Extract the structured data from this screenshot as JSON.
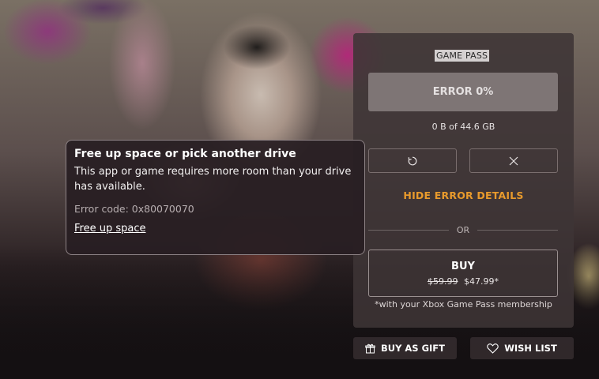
{
  "panel": {
    "badge": "GAME PASS",
    "progress_label": "ERROR 0%",
    "size_text": "0 B of 44.6 GB",
    "retry_icon": "retry-icon",
    "cancel_icon": "close-icon",
    "hide_error_label": "HIDE ERROR DETAILS",
    "or_label": "OR",
    "buy": {
      "label": "BUY",
      "old_price": "$59.99",
      "new_price": "$47.99*"
    },
    "membership_note": "*with your Xbox Game Pass membership"
  },
  "actions": {
    "gift_label": "BUY AS GIFT",
    "gift_icon": "gift-icon",
    "wish_label": "WISH LIST",
    "wish_icon": "heart-icon"
  },
  "error_popup": {
    "title": "Free up space or pick another drive",
    "body": "This app or game requires more room than your drive has available.",
    "code": "Error code: 0x80070070",
    "link": "Free up space"
  },
  "colors": {
    "accent": "#e89a2c",
    "panel_bg": "#3e3436",
    "badge_bg": "#d4d0d0"
  }
}
